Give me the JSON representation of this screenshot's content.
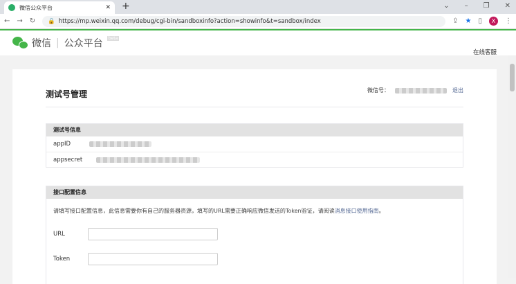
{
  "browser": {
    "tab_title": "微信公众平台",
    "url": "https://mp.weixin.qq.com/debug/cgi-bin/sandboxinfo?action=showinfo&t=sandbox/index",
    "profile_initial": "X"
  },
  "header": {
    "brand": "微信",
    "product": "公众平台",
    "kefu": "在线客服"
  },
  "page": {
    "title": "测试号管理",
    "wechat_label": "微信号：",
    "logout": "退出"
  },
  "test_info": {
    "title": "测试号信息",
    "appid_label": "appID",
    "appsecret_label": "appsecret"
  },
  "config": {
    "title": "接口配置信息",
    "desc": "请填写接口配置信息，此信息需要你有自己的服务器资源，填写的URL需要正确响应微信发送的Token验证，请阅读",
    "desc_link": "消息接口使用指南",
    "desc_end": "。",
    "url_label": "URL",
    "token_label": "Token",
    "url_value": "",
    "token_value": ""
  }
}
